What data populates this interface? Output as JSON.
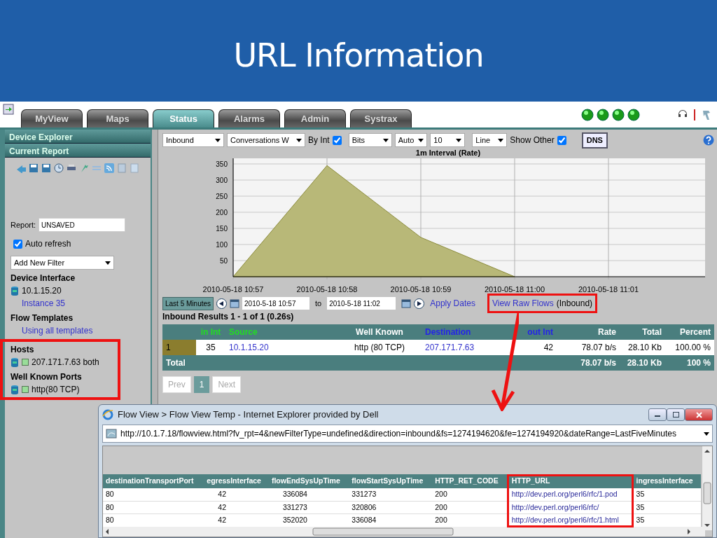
{
  "slide": {
    "title": "URL Information"
  },
  "tabs": [
    {
      "label": "MyView",
      "selected": false
    },
    {
      "label": "Maps",
      "selected": false
    },
    {
      "label": "Status",
      "selected": true
    },
    {
      "label": "Alarms",
      "selected": false
    },
    {
      "label": "Admin",
      "selected": false
    },
    {
      "label": "Systrax",
      "selected": false
    }
  ],
  "sidebar": {
    "headers": [
      "Device Explorer",
      "Current Report"
    ],
    "report_label": "Report:",
    "report_value": "UNSAVED",
    "auto_refresh": {
      "label": "Auto refresh",
      "checked": true
    },
    "filter_select": "Add New Filter",
    "sections": [
      {
        "title": "Device Interface",
        "items": [
          {
            "kind": "device",
            "text": "10.1.15.20"
          },
          {
            "kind": "link",
            "text": "Instance 35"
          }
        ]
      },
      {
        "title": "Flow Templates",
        "items": [
          {
            "kind": "link",
            "text": "Using all templates"
          }
        ]
      },
      {
        "title": "Hosts",
        "items": [
          {
            "kind": "filter",
            "text": "207.171.7.63 both"
          }
        ]
      },
      {
        "title": "Well Known Ports",
        "items": [
          {
            "kind": "filter",
            "text": "http(80 TCP)"
          }
        ]
      }
    ]
  },
  "toolbar": [
    {
      "kind": "select",
      "value": "Inbound"
    },
    {
      "kind": "select",
      "value": "Conversations W"
    },
    {
      "kind": "checkbox",
      "label": "By Int",
      "checked": true
    },
    {
      "kind": "select",
      "value": "Bits"
    },
    {
      "kind": "select",
      "value": "Auto"
    },
    {
      "kind": "select",
      "value": "10"
    },
    {
      "kind": "select",
      "value": "Line"
    },
    {
      "kind": "checkbox",
      "label": "Show Other",
      "checked": true
    },
    {
      "kind": "button",
      "label": "DNS"
    }
  ],
  "chart": {
    "chart_data": {
      "type": "area",
      "title": "1m Interval (Rate)",
      "categories": [
        "2010-05-18 10:57",
        "2010-05-18 10:58",
        "2010-05-18 10:59",
        "2010-05-18 11:00",
        "2010-05-18 11:01"
      ],
      "series": [
        {
          "color": "#b8b878",
          "values": [
            0,
            345,
            122,
            0,
            null
          ]
        }
      ],
      "ylim": [
        0,
        350
      ],
      "yticks": [
        50,
        100,
        150,
        200,
        250,
        300,
        350
      ],
      "grid": true
    }
  },
  "date_range": {
    "preset": "Last 5 Minutes",
    "from": "2010-5-18 10:57",
    "to_label": "to",
    "to": "2010-5-18 11:02",
    "apply": "Apply Dates",
    "raw_link": "View Raw Flows",
    "raw_note": "(Inbound)"
  },
  "results": {
    "summary": "Inbound Results 1 - 1 of 1 (0.26s)",
    "columns": [
      {
        "label": "in Int",
        "kind": "ingress"
      },
      {
        "label": "Source",
        "kind": "ingress_link"
      },
      {
        "label": "Well Known",
        "kind": "text"
      },
      {
        "label": "Destination",
        "kind": "egress_link"
      },
      {
        "label": "out Int",
        "kind": "egress"
      },
      {
        "label": "Rate",
        "kind": "text"
      },
      {
        "label": "Total",
        "kind": "text"
      },
      {
        "label": "Percent",
        "kind": "text"
      }
    ],
    "rows": [
      {
        "rank": "1",
        "color": "#8b7d2e",
        "cells": [
          "35",
          "10.1.15.20",
          "http (80 TCP)",
          "207.171.7.63",
          "42",
          "78.07 b/s",
          "28.10 Kb",
          "100.00 %"
        ]
      }
    ],
    "total": {
      "label": "Total",
      "cells": [
        "78.07 b/s",
        "28.10 Kb",
        "100 %"
      ]
    },
    "pages": [
      {
        "label": "Prev",
        "selected": false
      },
      {
        "label": "1",
        "selected": true
      },
      {
        "label": "Next",
        "selected": false
      }
    ]
  },
  "popup": {
    "title": "Flow View > Flow View Temp - Internet Explorer provided by Dell",
    "address": "http://10.1.7.18/flowview.html?fv_rpt=4&newFilterType=undefined&direction=inbound&fs=1274194620&fe=1274194920&dateRange=LastFiveMinutes",
    "columns": [
      {
        "label": "destinationTransportPort",
        "kind": "text"
      },
      {
        "label": "egressInterface",
        "kind": "text"
      },
      {
        "label": "flowEndSysUpTime",
        "kind": "text"
      },
      {
        "label": "flowStartSysUpTime",
        "kind": "text"
      },
      {
        "label": "HTTP_RET_CODE",
        "kind": "text"
      },
      {
        "label": "HTTP_URL",
        "kind": "link"
      },
      {
        "label": "ingressInterface",
        "kind": "text"
      }
    ],
    "rows": [
      [
        "80",
        "42",
        "336084",
        "331273",
        "200",
        "http://dev.perl.org/perl6/rfc/1.pod",
        "35"
      ],
      [
        "80",
        "42",
        "331273",
        "320806",
        "200",
        "http://dev.perl.org/perl6/rfc/",
        "35"
      ],
      [
        "80",
        "42",
        "352020",
        "336084",
        "200",
        "http://dev.perl.org/perl6/rfc/1.html",
        "35"
      ]
    ]
  }
}
